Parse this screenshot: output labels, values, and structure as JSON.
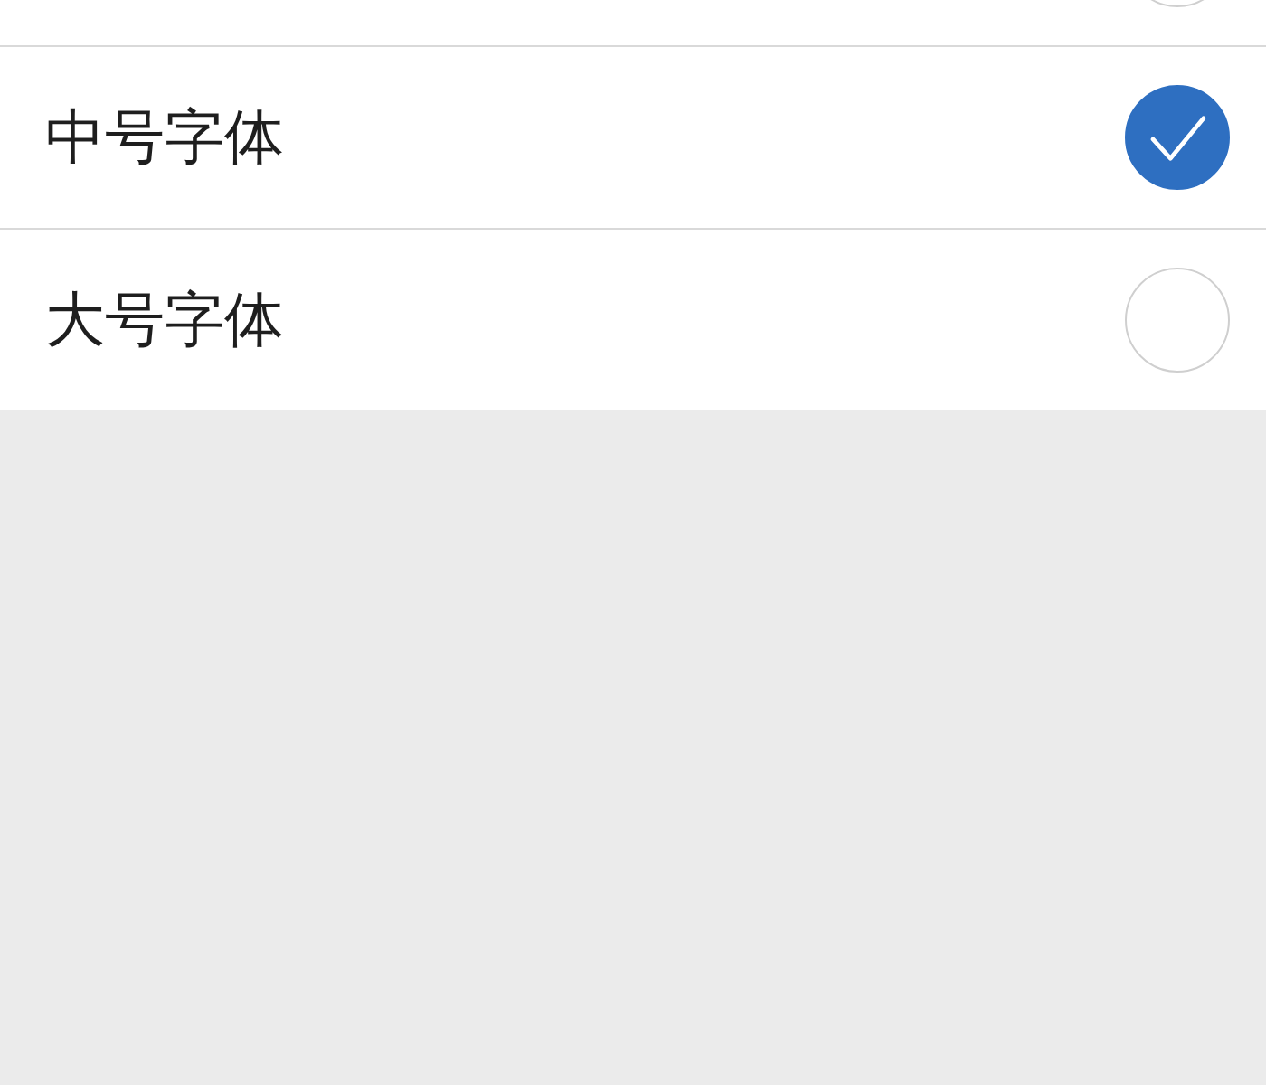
{
  "options": [
    {
      "selected": false
    },
    {
      "label": "中号字体",
      "selected": true
    },
    {
      "label": "大号字体",
      "selected": false
    }
  ]
}
